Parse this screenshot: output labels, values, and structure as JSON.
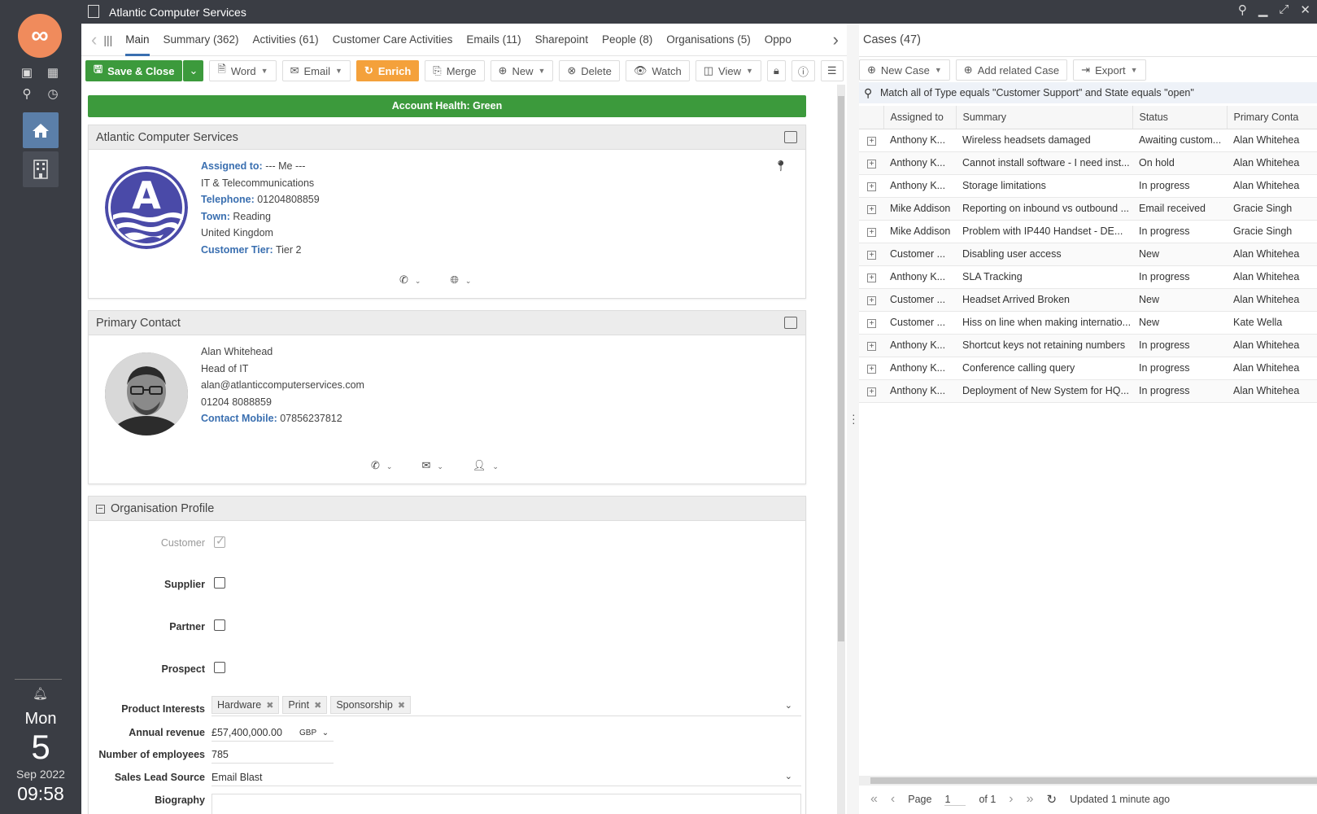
{
  "window": {
    "title": "Atlantic Computer Services"
  },
  "rail": {
    "day_of_week": "Mon",
    "day": "5",
    "month_year": "Sep 2022",
    "time": "09:58"
  },
  "tabs": [
    {
      "label": "Main"
    },
    {
      "label": "Summary (362)"
    },
    {
      "label": "Activities (61)"
    },
    {
      "label": "Customer Care Activities"
    },
    {
      "label": "Emails (11)"
    },
    {
      "label": "Sharepoint"
    },
    {
      "label": "People (8)"
    },
    {
      "label": "Organisations (5)"
    },
    {
      "label": "Oppo"
    }
  ],
  "toolbar": {
    "save_close": "Save & Close",
    "word": "Word",
    "email": "Email",
    "enrich": "Enrich",
    "merge": "Merge",
    "new": "New",
    "delete": "Delete",
    "watch": "Watch",
    "view": "View"
  },
  "health": "Account Health: Green",
  "org_card": {
    "title": "Atlantic Computer Services",
    "assigned_label": "Assigned to:",
    "assigned_value": "--- Me ---",
    "industry": "IT & Telecommunications",
    "telephone_label": "Telephone:",
    "telephone_value": "01204808859",
    "town_label": "Town:",
    "town_value": "Reading",
    "country": "United Kingdom",
    "tier_label": "Customer Tier:",
    "tier_value": "Tier 2"
  },
  "contact_card": {
    "title": "Primary Contact",
    "name": "Alan Whitehead",
    "job": "Head of IT",
    "email": "alan@atlanticcomputerservices.com",
    "phone": "01204 8088859",
    "mobile_label": "Contact Mobile:",
    "mobile_value": "07856237812"
  },
  "profile": {
    "title": "Organisation Profile",
    "customer": "Customer",
    "supplier": "Supplier",
    "partner": "Partner",
    "prospect": "Prospect",
    "product_interests_label": "Product Interests",
    "product_interests": [
      "Hardware",
      "Print",
      "Sponsorship"
    ],
    "annual_revenue_label": "Annual revenue",
    "annual_revenue": "£57,400,000.00",
    "currency": "GBP",
    "employees_label": "Number of employees",
    "employees": "785",
    "lead_source_label": "Sales Lead Source",
    "lead_source": "Email Blast",
    "biography_label": "Biography",
    "customer_checked": true,
    "supplier_checked": false,
    "partner_checked": false,
    "prospect_checked": false
  },
  "cases": {
    "title": "Cases (47)",
    "new_case": "New Case",
    "add_related": "Add related Case",
    "export": "Export",
    "filter": "Match all of Type equals \"Customer Support\" and State equals \"open\"",
    "columns": [
      "Assigned to",
      "Summary",
      "Status",
      "Primary Conta"
    ],
    "rows": [
      [
        "Anthony K...",
        "Wireless headsets damaged",
        "Awaiting custom...",
        "Alan Whitehea"
      ],
      [
        "Anthony K...",
        "Cannot install software - I need inst...",
        "On hold",
        "Alan Whitehea"
      ],
      [
        "Anthony K...",
        "Storage limitations",
        "In progress",
        "Alan Whitehea"
      ],
      [
        "Mike Addison",
        "Reporting on inbound vs outbound ...",
        "Email received",
        "Gracie Singh"
      ],
      [
        "Mike Addison",
        "Problem with IP440 Handset - DE...",
        "In progress",
        "Gracie Singh"
      ],
      [
        "Customer ...",
        "Disabling user access",
        "New",
        "Alan Whitehea"
      ],
      [
        "Anthony K...",
        "SLA Tracking",
        "In progress",
        "Alan Whitehea"
      ],
      [
        "Customer ...",
        "Headset Arrived Broken",
        "New",
        "Alan Whitehea"
      ],
      [
        "Customer ...",
        "Hiss on line when making internatio...",
        "New",
        "Kate Wella"
      ],
      [
        "Anthony K...",
        "Shortcut keys not retaining numbers",
        "In progress",
        "Alan Whitehea"
      ],
      [
        "Anthony K...",
        "Conference calling query",
        "In progress",
        "Alan Whitehea"
      ],
      [
        "Anthony K...",
        "Deployment of New System for HQ...",
        "In progress",
        "Alan Whitehea"
      ]
    ],
    "pager": {
      "page_label": "Page",
      "page": "1",
      "of": "of 1",
      "updated": "Updated 1 minute ago"
    }
  },
  "colors": {
    "accent": "#3a6fb0",
    "green": "#3c9a3c",
    "orange": "#f4a13b",
    "rail": "#3a3d44"
  }
}
